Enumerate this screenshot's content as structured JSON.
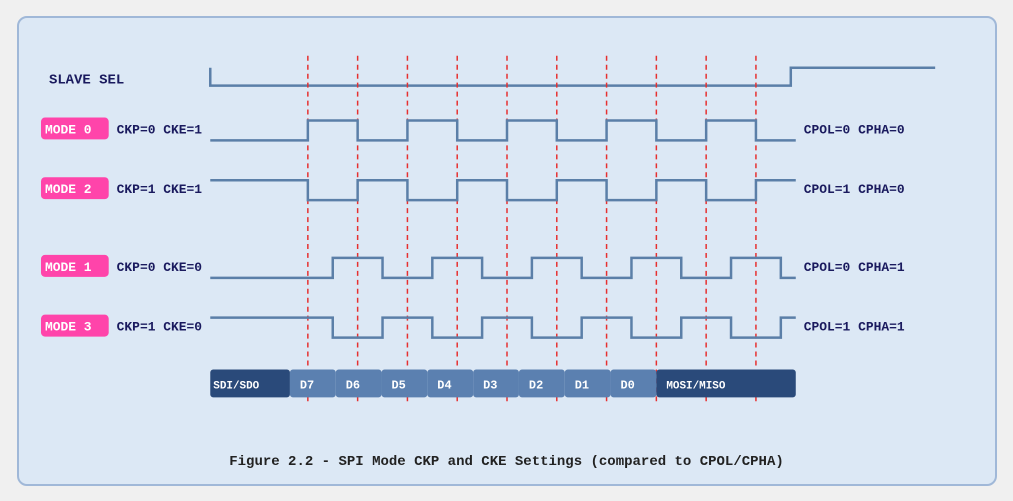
{
  "caption": "Figure 2.2 - SPI Mode CKP and CKE Settings (compared to CPOL/CPHA)",
  "diagram": {
    "slave_sel_label": "SLAVE SEL",
    "modes": [
      {
        "label": "MODE 0",
        "params": "CKP=0  CKE=1",
        "right": "CPOL=0  CPHA=0"
      },
      {
        "label": "MODE 2",
        "params": "CKP=1  CKE=1",
        "right": "CPOL=1  CPHA=0"
      },
      {
        "label": "MODE 1",
        "params": "CKP=0  CKE=0",
        "right": "CPOL=0  CPHA=1"
      },
      {
        "label": "MODE 3",
        "params": "CKP=1  CKE=0",
        "right": "CPOL=1  CPHA=1"
      }
    ],
    "data_bits": [
      "SDI/SDO",
      "D7",
      "D6",
      "D5",
      "D4",
      "D3",
      "D2",
      "D1",
      "D0",
      "MOSI/MISO"
    ]
  }
}
